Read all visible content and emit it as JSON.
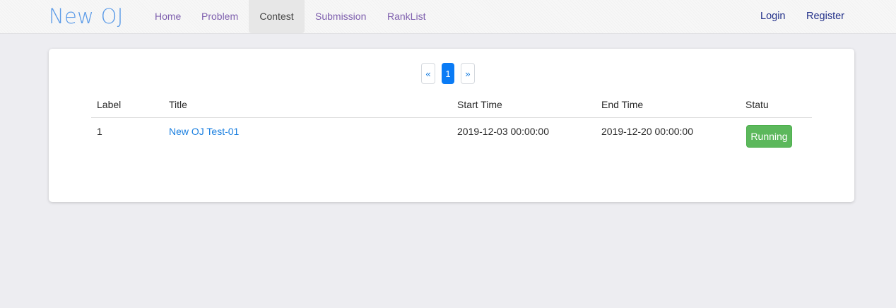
{
  "header": {
    "brand": "New OJ",
    "nav": [
      {
        "label": "Home"
      },
      {
        "label": "Problem"
      },
      {
        "label": "Contest"
      },
      {
        "label": "Submission"
      },
      {
        "label": "RankList"
      }
    ],
    "active_nav": "Contest",
    "login_label": "Login",
    "register_label": "Register"
  },
  "pagination": {
    "prev_label": "«",
    "current_page": "1",
    "next_label": "»"
  },
  "table": {
    "columns": [
      "Label",
      "Title",
      "Start Time",
      "End Time",
      "Statu"
    ],
    "rows": [
      {
        "label": "1",
        "title": "New OJ Test-01",
        "start_time": "2019-12-03 00:00:00",
        "end_time": "2019-12-20 00:00:00",
        "status": "Running"
      }
    ]
  },
  "colors": {
    "brand": "#5d9ce8",
    "nav_link": "#7e5fae",
    "auth_link": "#23318a",
    "link": "#1a7fe0",
    "pager_active": "#0a7bf5",
    "status_running": "#5cb85c",
    "page_background": "#ededf1"
  }
}
